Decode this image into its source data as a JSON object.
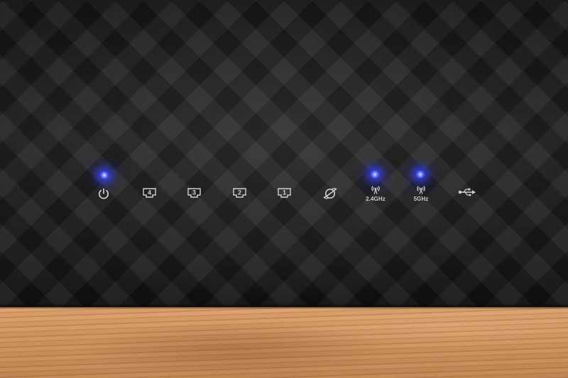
{
  "scene": {
    "description_type": "router-front-panel-photo"
  },
  "status_indicators": [
    {
      "name": "power",
      "icon": "power-icon",
      "led_on": true,
      "label": ""
    },
    {
      "name": "lan-4",
      "icon": "ethernet-port-icon",
      "led_on": false,
      "label": "4"
    },
    {
      "name": "lan-3",
      "icon": "ethernet-port-icon",
      "led_on": false,
      "label": "3"
    },
    {
      "name": "lan-2",
      "icon": "ethernet-port-icon",
      "led_on": false,
      "label": "2"
    },
    {
      "name": "lan-1",
      "icon": "ethernet-port-icon",
      "led_on": false,
      "label": "1"
    },
    {
      "name": "wan",
      "icon": "internet-globe-icon",
      "led_on": false,
      "label": ""
    },
    {
      "name": "wifi-2-4ghz",
      "icon": "wifi-antenna-icon",
      "led_on": true,
      "label": "2.4GHz"
    },
    {
      "name": "wifi-5ghz",
      "icon": "wifi-antenna-icon",
      "led_on": true,
      "label": "5GHz"
    },
    {
      "name": "usb",
      "icon": "usb-icon",
      "led_on": false,
      "label": ""
    }
  ],
  "colors": {
    "led_blue": "#3d4bff",
    "panel_black": "#1c1c1c",
    "icon_gray": "#d0d0d0",
    "wood": "#c98f5d"
  }
}
